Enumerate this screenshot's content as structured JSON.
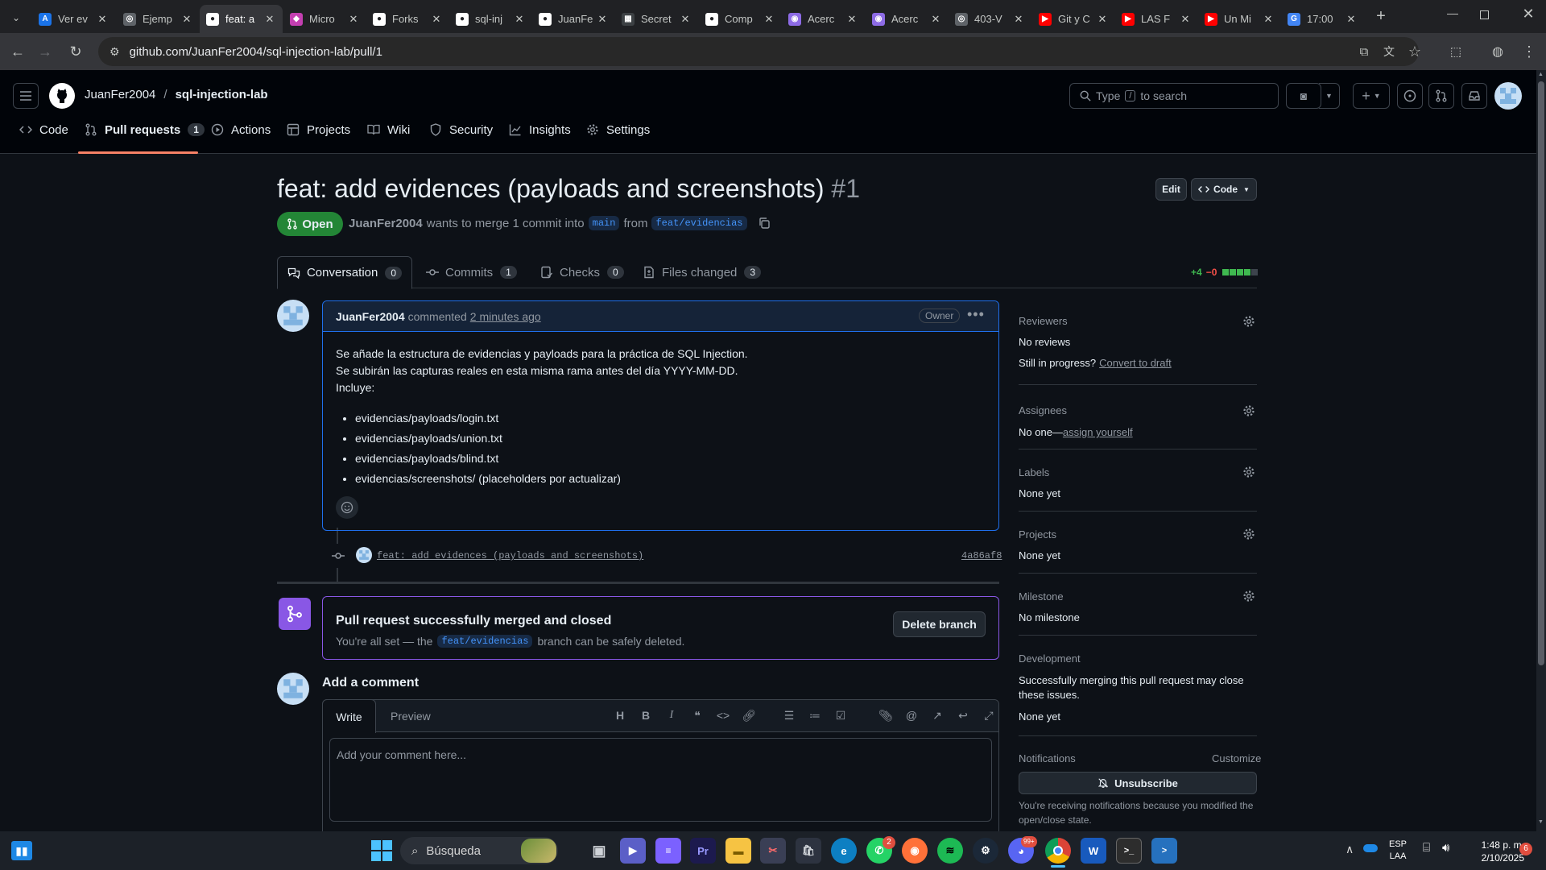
{
  "browser": {
    "tabs": [
      {
        "title": "Ver ev",
        "fav_color": "#1a73e8",
        "fav_text": "A"
      },
      {
        "title": "Ejemp",
        "fav_color": "#5f6368",
        "fav_text": "◎"
      },
      {
        "title": "feat: a",
        "fav_color": "#ffffff",
        "fav_text": "●",
        "active": true
      },
      {
        "title": "Micro",
        "fav_color": "#c43fb1",
        "fav_text": "◆"
      },
      {
        "title": "Forks",
        "fav_color": "#ffffff",
        "fav_text": "●"
      },
      {
        "title": "sql-inj",
        "fav_color": "#ffffff",
        "fav_text": "●"
      },
      {
        "title": "JuanFe",
        "fav_color": "#ffffff",
        "fav_text": "●"
      },
      {
        "title": "Secret",
        "fav_color": "#3c4043",
        "fav_text": "▦"
      },
      {
        "title": "Comp",
        "fav_color": "#ffffff",
        "fav_text": "●"
      },
      {
        "title": "Acerc",
        "fav_color": "#8d6be5",
        "fav_text": "◉"
      },
      {
        "title": "Acerc",
        "fav_color": "#8d6be5",
        "fav_text": "◉"
      },
      {
        "title": "403-V",
        "fav_color": "#5f6368",
        "fav_text": "◎"
      },
      {
        "title": "Git y C",
        "fav_color": "#ff0000",
        "fav_text": "▶"
      },
      {
        "title": "LAS F",
        "fav_color": "#ff0000",
        "fav_text": "▶"
      },
      {
        "title": "Un Mi",
        "fav_color": "#ff0000",
        "fav_text": "▶"
      },
      {
        "title": "17:00",
        "fav_color": "#4285f4",
        "fav_text": "G"
      }
    ],
    "url": "github.com/JuanFer2004/sql-injection-lab/pull/1"
  },
  "gh": {
    "owner": "JuanFer2004",
    "slash": "/",
    "repo": "sql-injection-lab",
    "search_type": "Type",
    "search_key": "/",
    "search_rest": "to search",
    "nav": [
      {
        "label": "Code"
      },
      {
        "label": "Pull requests",
        "count": "1"
      },
      {
        "label": "Actions"
      },
      {
        "label": "Projects"
      },
      {
        "label": "Wiki"
      },
      {
        "label": "Security"
      },
      {
        "label": "Insights"
      },
      {
        "label": "Settings"
      }
    ]
  },
  "pr": {
    "title": "feat: add evidences (payloads and screenshots)",
    "number": "#1",
    "edit_label": "Edit",
    "code_label": "Code",
    "state": "Open",
    "author": "JuanFer2004",
    "merge_text": "wants to merge 1 commit into",
    "base": "main",
    "from_text": "from",
    "head": "feat/evidencias",
    "tabs": [
      {
        "label": "Conversation",
        "count": "0"
      },
      {
        "label": "Commits",
        "count": "1"
      },
      {
        "label": "Checks",
        "count": "0"
      },
      {
        "label": "Files changed",
        "count": "3"
      }
    ],
    "additions": "+4",
    "deletions": "−0",
    "comment": {
      "author": "JuanFer2004",
      "action": "commented",
      "time": "2 minutes ago",
      "badge": "Owner",
      "lines": [
        "Se añade la estructura de evidencias y payloads para la práctica de SQL Injection.",
        "Se subirán las capturas reales en esta misma rama antes del día YYYY-MM-DD.",
        "Incluye:"
      ],
      "bullets": [
        "evidencias/payloads/login.txt",
        "evidencias/payloads/union.txt",
        "evidencias/payloads/blind.txt",
        "evidencias/screenshots/ (placeholders por actualizar)"
      ]
    },
    "commit": {
      "message": "feat: add evidences (payloads and screenshots)",
      "sha": "4a86af8"
    },
    "merged": {
      "title": "Pull request successfully merged and closed",
      "text_before": "You're all set — the",
      "branch": "feat/evidencias",
      "text_after": "branch can be safely deleted.",
      "delete_label": "Delete branch"
    },
    "add_comment": {
      "heading": "Add a comment",
      "write_tab": "Write",
      "preview_tab": "Preview",
      "placeholder": "Add your comment here...",
      "heading_tool": "H"
    }
  },
  "sidebar": {
    "reviewers_label": "Reviewers",
    "reviewers_value": "No reviews",
    "in_progress": "Still in progress?",
    "convert_draft": "Convert to draft",
    "assignees_label": "Assignees",
    "assignees_value": "No one—",
    "assign_yourself": "assign yourself",
    "labels_label": "Labels",
    "labels_value": "None yet",
    "projects_label": "Projects",
    "projects_value": "None yet",
    "milestone_label": "Milestone",
    "milestone_value": "No milestone",
    "development_label": "Development",
    "development_text": "Successfully merging this pull request may close these issues.",
    "development_value": "None yet",
    "notifications_label": "Notifications",
    "customize": "Customize",
    "unsubscribe": "Unsubscribe",
    "notif_reason": "You're receiving notifications because you modified the open/close state."
  },
  "taskbar": {
    "search": "Búsqueda",
    "lang1": "ESP",
    "lang2": "LAA",
    "time": "1:48 p. m.",
    "date": "2/10/2025",
    "notif_count": "6",
    "whatsapp_badge": "2",
    "discord_badge": "99+"
  }
}
